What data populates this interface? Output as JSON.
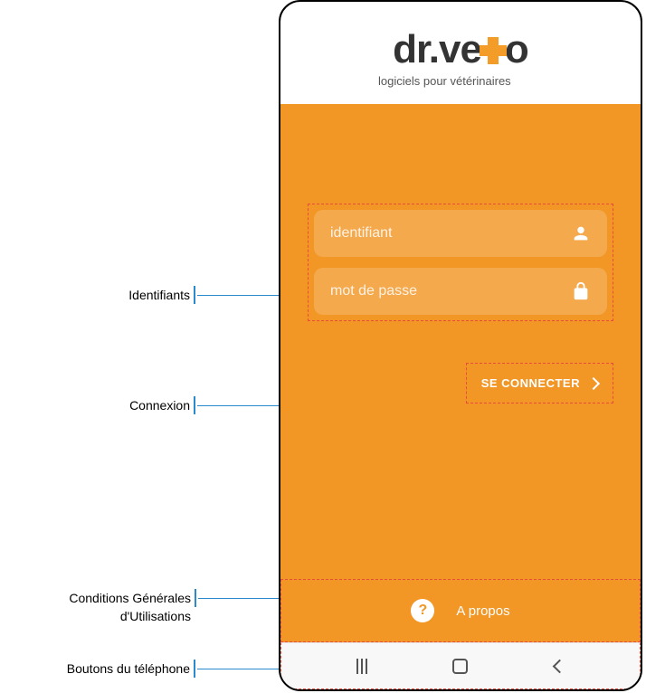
{
  "logo": {
    "prefix": "dr.ve",
    "suffix": "o",
    "tagline": "logiciels pour vétérinaires"
  },
  "login": {
    "identifiant_placeholder": "identifiant",
    "password_placeholder": "mot de passe",
    "connect_label": "SE CONNECTER"
  },
  "about": {
    "label": "A propos",
    "help_symbol": "?"
  },
  "callouts": {
    "identifiants": "Identifiants",
    "connexion": "Connexion",
    "cgu": "Conditions Générales d'Utilisations",
    "phone_buttons": "Boutons du téléphone"
  },
  "colors": {
    "brand_orange": "#f29626",
    "callout_blue": "#2a8acb"
  }
}
